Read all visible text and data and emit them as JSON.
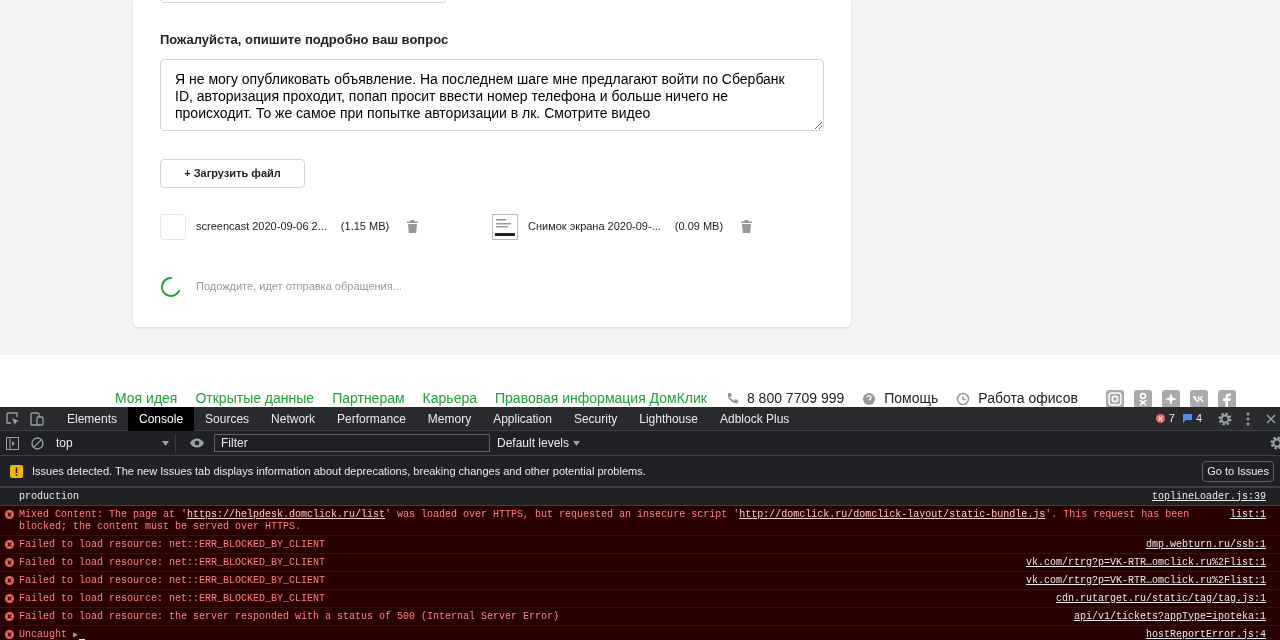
{
  "form": {
    "question_label": "Пожалуйста, опишите подробно ваш вопрос",
    "question_value": "Я не могу опубликовать объявление. На последнем шаге мне предлагают войти по Сбербанк ID, авторизация проходит, попап просит ввести номер телефона и больше ничего не происходит. То же самое при попытке авторизации в лк. Смотрите видео",
    "upload_button": "+ Загрузить файл",
    "files": [
      {
        "kind": "video",
        "name": "screencast 2020-09-06 2...",
        "size": "(1.15 MB)"
      },
      {
        "kind": "image",
        "name": "Снимок экрана 2020-09-...",
        "size": "(0.09 MB)"
      }
    ],
    "status": "Подождите, идет отправка обращения..."
  },
  "footer": {
    "links": [
      "Моя идея",
      "Открытые данные",
      "Партнерам",
      "Карьера",
      "Правовая информация ДомКлик"
    ],
    "contacts": [
      {
        "kind": "phone",
        "text": "8 800 7709 999"
      },
      {
        "kind": "help",
        "text": "Помощь"
      },
      {
        "kind": "clock",
        "text": "Работа офисов"
      }
    ]
  },
  "devtools": {
    "tabs": [
      {
        "label": "Elements",
        "selected": false
      },
      {
        "label": "Console",
        "selected": true
      },
      {
        "label": "Sources",
        "selected": false
      },
      {
        "label": "Network",
        "selected": false
      },
      {
        "label": "Performance",
        "selected": false
      },
      {
        "label": "Memory",
        "selected": false
      },
      {
        "label": "Application",
        "selected": false
      },
      {
        "label": "Security",
        "selected": false
      },
      {
        "label": "Lighthouse",
        "selected": false
      },
      {
        "label": "Adblock Plus",
        "selected": false
      }
    ],
    "error_count": "7",
    "message_count": "4",
    "context": "top",
    "filter_placeholder": "Filter",
    "levels": "Default levels",
    "issues_text": "Issues detected. The new Issues tab displays information about deprecations, breaking changes and other potential problems.",
    "issues_button": "Go to Issues",
    "messages": [
      {
        "kind": "log",
        "parts": [
          {
            "kind": "text",
            "text": "production"
          }
        ],
        "source": "toplineLoader.js:39"
      },
      {
        "kind": "error",
        "parts": [
          {
            "kind": "text",
            "text": "Mixed Content: The page at '"
          },
          {
            "kind": "link",
            "text": "https://helpdesk.domclick.ru/list"
          },
          {
            "kind": "text",
            "text": "' was loaded over HTTPS, but requested an insecure script '"
          },
          {
            "kind": "link",
            "text": "http://domclick.ru/domclick-layout/static-bundle.js"
          },
          {
            "kind": "text",
            "text": "'. This request has been blocked; the content must be served over HTTPS."
          }
        ],
        "source": "list:1"
      },
      {
        "kind": "error",
        "parts": [
          {
            "kind": "text",
            "text": "Failed to load resource: net::ERR_BLOCKED_BY_CLIENT"
          }
        ],
        "source": "dmp.webturn.ru/ssb:1"
      },
      {
        "kind": "error",
        "parts": [
          {
            "kind": "text",
            "text": "Failed to load resource: net::ERR_BLOCKED_BY_CLIENT"
          }
        ],
        "source": "vk.com/rtrg?p=VK-RTR…omclick.ru%2Flist:1"
      },
      {
        "kind": "error",
        "parts": [
          {
            "kind": "text",
            "text": "Failed to load resource: net::ERR_BLOCKED_BY_CLIENT"
          }
        ],
        "source": "vk.com/rtrg?p=VK-RTR…omclick.ru%2Flist:1"
      },
      {
        "kind": "error",
        "parts": [
          {
            "kind": "text",
            "text": "Failed to load resource: net::ERR_BLOCKED_BY_CLIENT"
          }
        ],
        "source": "cdn.rutarget.ru/static/tag/tag.js:1"
      },
      {
        "kind": "error",
        "parts": [
          {
            "kind": "text",
            "text": "Failed to load resource: the server responded with a status of 500 (Internal Server Error)"
          }
        ],
        "source": "api/v1/tickets?appType=ipoteka:1"
      },
      {
        "kind": "error",
        "parts": [
          {
            "kind": "text",
            "text": "Uncaught"
          }
        ],
        "expander": "▶",
        "source": "hostReportError.js:4"
      }
    ]
  }
}
